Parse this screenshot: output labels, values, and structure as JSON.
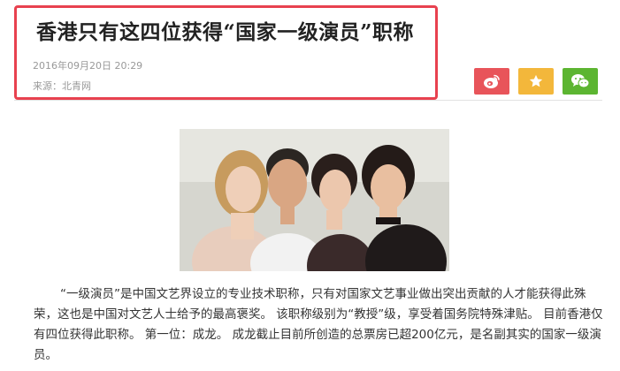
{
  "article": {
    "title": "香港只有这四位获得“国家一级演员”职称",
    "date": "2016年09月20日 20:29",
    "source": "来源：北青网",
    "body": "“一级演员”是中国文艺界设立的专业技术职称，只有对国家文艺事业做出突出贡献的人才能获得此殊荣，这也是中国对文艺人士给予的最高褒奖。 该职称级别为“教授”级，享受着国务院特殊津贴。 目前香港仅有四位获得此职称。 第一位：成龙。 成龙截止目前所创造的总票房已超200亿元，是名副其实的国家一级演员。"
  },
  "share": [
    {
      "icon": "weibo-icon",
      "color": "#e8545a"
    },
    {
      "icon": "star-icon",
      "color": "#f3b73b"
    },
    {
      "icon": "wechat-icon",
      "color": "#5cb531"
    }
  ],
  "colors": {
    "highlight_border": "#e8414f",
    "title": "#222222",
    "meta": "#999999",
    "body": "#333333"
  }
}
